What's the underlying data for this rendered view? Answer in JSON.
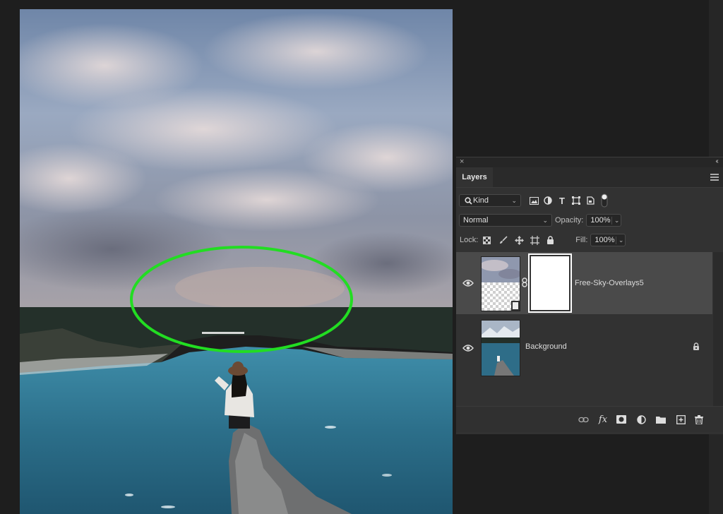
{
  "panel": {
    "tab": "Layers",
    "filter": {
      "label": "Kind"
    },
    "blend_mode": "Normal",
    "opacity_label": "Opacity:",
    "opacity_value": "100%",
    "lock_label": "Lock:",
    "fill_label": "Fill:",
    "fill_value": "100%"
  },
  "layers": [
    {
      "name": "Free-Sky-Overlays5",
      "visible": true,
      "selected": true,
      "has_mask": true
    },
    {
      "name": "Background",
      "visible": true,
      "selected": false,
      "locked": true
    }
  ],
  "icons": {
    "filter": [
      "image-filter-icon",
      "adjustment-filter-icon",
      "type-filter-icon",
      "shape-filter-icon",
      "smart-object-filter-icon",
      "filter-toggle-icon"
    ],
    "lock": [
      "lock-transparent-icon",
      "lock-paint-icon",
      "lock-position-icon",
      "lock-artboard-icon",
      "lock-all-icon"
    ],
    "bottom": [
      "link-layers-icon",
      "fx-icon",
      "add-mask-icon",
      "adjustment-layer-icon",
      "group-icon",
      "new-layer-icon",
      "delete-layer-icon"
    ]
  },
  "colors": {
    "highlight_ellipse": "#22dd22",
    "panel_bg": "#323232",
    "selected_layer": "#4a4a4a"
  }
}
